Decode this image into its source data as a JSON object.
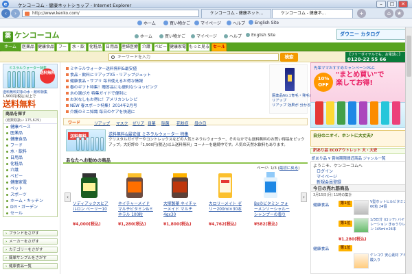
{
  "window": {
    "title": "ケンコーコム - 健康ネットショップ - Internet Explorer",
    "min_label": "–",
    "max_label": "□",
    "close_label": "✕"
  },
  "address": {
    "url": "http://www.kenko.com/",
    "tab1": "ケンコーコム - 健康ネット...",
    "tab2": "ケンコーコム - 健康ネ..."
  },
  "favorites": [
    {
      "label": "ホーム",
      "icon": "home-icon"
    },
    {
      "label": "買い物かご",
      "icon": "cart-icon"
    },
    {
      "label": "マイページ",
      "icon": "user-icon"
    },
    {
      "label": "ヘルプ",
      "icon": "help-icon"
    },
    {
      "label": "English Site",
      "icon": "flag-icon"
    }
  ],
  "header": {
    "logo_mark": "薬",
    "logo_text": "ケンコーコム",
    "links": [
      "ホーム",
      "買い物かご",
      "マイページ",
      "ヘルプ",
      "English Site"
    ],
    "catalog": "ダウニー カタログ"
  },
  "nav": {
    "tabs": [
      "ホーム",
      "医薬品",
      "健康食品",
      "フード",
      "水・飲料",
      "化粧品",
      "日用品",
      "産婦医療",
      "介護",
      "ベビー",
      "健康家電",
      "もっと見る",
      "セール"
    ]
  },
  "search": {
    "placeholder": "キーワードを入力",
    "button": "検索",
    "phone_label": "【フリーダイヤルでも、お電話に】",
    "phone": "0120-22 55 66"
  },
  "left": {
    "banner_title": "ミネラルウォーター特集",
    "banner_free": "送料無料",
    "banner_line1": "送料無料対象の水・飲料特集",
    "banner_line2": "1,900円(税込)以上で",
    "big_free": "送料無料",
    "cat_head": "商品を探す",
    "cat_sub": "(総数取扱い 175,629)",
    "categories": [
      "健康ベース",
      "医薬品",
      "健康食品",
      "フード",
      "水・飲料",
      "日用品",
      "化粧品",
      "介護",
      "ベビー",
      "健康家電",
      "ペット",
      "スポーツ",
      "ホーム・キッチン",
      "DIY・ガーデン",
      "セール"
    ],
    "buttons": [
      "ブランドをさがす",
      "メーカーをさがす",
      "カテゴリーをさがす",
      "簡単サンプルをさがす",
      "健康食品一覧"
    ]
  },
  "news": [
    "ミネラルウォーター送料無料&最安値",
    "食品・飲料にリアップX5・リアップジェット",
    "健康食品・サプリ 毎日使えるお得な情報",
    "春のギフト特集！贈答品にも便利なショッピング",
    "水の選び方 特集ガイドで便利に",
    "お米なしもお得に！アメリカンレシピ",
    "NEW 春スポーツ特集！2014年2月号",
    "介護のミニ知識 毎日のケアを快適に"
  ],
  "news_image": {
    "caption1": "医薬品No.1育毛・発毛に",
    "caption2": "リアップ",
    "caption3": "リアップ 効果が 分かる！"
  },
  "wordbar": {
    "label": "ワード",
    "links": [
      "リアップ",
      "マスク",
      "ゼリア",
      "目薬",
      "除菌",
      "花粉症",
      "母の日"
    ]
  },
  "promo": {
    "badge": "送料無料",
    "title": "送料無料&最安値 ミネラルウォーター 特集",
    "text": "クリスタルガイザーやコントレックスなどの人気ミネラルウォーター、そのなかでも送料無料のお買い得品をピックアップ。大好評の「1,900円(税込)以上送料無料」コーナーを継続中です。人気の天然水飲料もあります。"
  },
  "recommend": {
    "heading": "あなたへお勧めの商品",
    "page_prefix": "ページ: 1/3 (",
    "page_link": "最初に戻る",
    "page_suffix": ")",
    "prev": "‹",
    "next": "›",
    "products": [
      {
        "name": "ソディアックスヒアルロン ベーリー10",
        "price": "¥4,000(税込)",
        "color": "#1b5e20"
      },
      {
        "name": "ネイチャーメイド マルチビタミン&ミネラル 100粒",
        "price": "¥1,280(税込)",
        "color": "#ff6f00"
      },
      {
        "name": "大塚製薬 ネイチャーメイド マルチ 4gx30",
        "price": "¥1,800(税込)",
        "color": "#bf360c"
      },
      {
        "name": "カロリーメイト ゼリー200ml×30本",
        "price": "¥4,762(税込)",
        "color": "#fbc02d"
      },
      {
        "name": "Bxのビタミン フォーメンソーシャルーシャンプーの香り",
        "price": "¥582(税込)",
        "color": "#1e88e5"
      }
    ]
  },
  "right": {
    "banner_campaign": "先輩ママおすすめキャンペーンP&G",
    "banner_big1": "\"まとめ買い\"で",
    "banner_big2": "楽してお得!",
    "banner_off": "10% OFF",
    "banner3": "自分のニオイ、ホントに大丈夫?",
    "banner4": "訳あり品 ECOアウトレット 大・大安",
    "outlet_link": "訳あり品 ¥ 賞味期限間近商品 ジャンル一覧",
    "welcome": "ようこそ、ケンコーコムへ",
    "welcome_links": [
      "ログイン",
      "マイページ",
      "新規会員登録"
    ],
    "rank_head": "今日の売れ筋商品",
    "rank_date": "3月15日(月) 11時の集計",
    "ranks": [
      {
        "cat": "健康食品",
        "badge": "第1位",
        "name": "V型ホットヒルビタミン 60粒 24個",
        "price": "¥1,280(税込)"
      },
      {
        "cat": "",
        "badge": "第1位",
        "name": "1/3日分 (ロッテ) バイソレーション きゅうりレモン 145ml×24本",
        "price": "¥1,142(税込)"
      },
      {
        "cat": "健康食品",
        "badge": "第1位",
        "name": "ケンコウ 安心素材 アミノ酸入り",
        "price": ""
      }
    ]
  }
}
